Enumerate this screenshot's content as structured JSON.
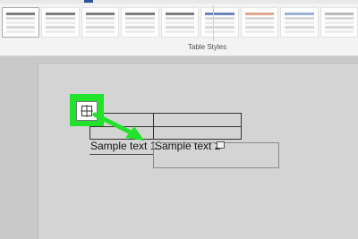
{
  "ribbon": {
    "group_label": "Table Styles",
    "style_count": 9,
    "style_colors": [
      "#7d7d7d",
      "#7d7d7d",
      "#7d7d7d",
      "#7d7d7d",
      "#7d7d7d",
      "#6b86b8",
      "#e0a98f",
      "#9db0d6",
      "#b9b9b9"
    ]
  },
  "document": {
    "cells": [
      {
        "text": "Sample text 1"
      },
      {
        "text": "Sample text 2"
      }
    ]
  },
  "highlight": {
    "color": "#22e22b",
    "icon": "table-move-handle-icon"
  }
}
